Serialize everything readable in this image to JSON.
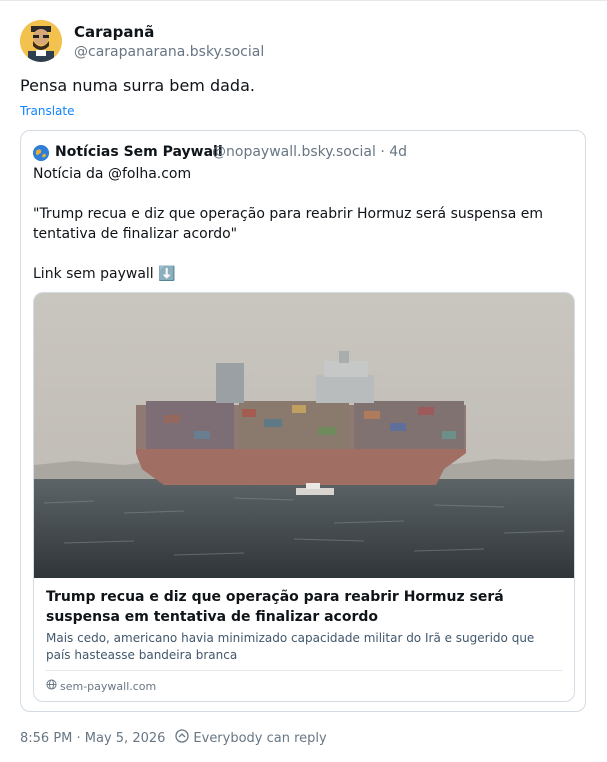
{
  "post": {
    "author_name": "Carapanã",
    "author_handle": "@carapanarana.bsky.social",
    "text": "Pensa numa surra bem dada.",
    "translate_label": "Translate",
    "timestamp": "8:56 PM · May 5, 2026",
    "reply_setting": "Everybody can reply"
  },
  "quote": {
    "author_name": "Notícias Sem Paywall",
    "author_handle": "@nopaywall.bsky.social · 4d",
    "text": "Notícia da @folha.com\n\n\"Trump recua e diz que operação para reabrir Hormuz será suspensa em tentativa de finalizar acordo\"\n\nLink sem paywall ⬇️",
    "card": {
      "title": "Trump recua e diz que operação para reabrir Hormuz será suspensa em tentativa de finalizar acordo",
      "description": "Mais cedo, americano havia minimizado capacidade militar do Irã e sugerido que país hasteasse bandeira branca",
      "domain": "sem-paywall.com"
    }
  },
  "icons": {
    "globe": "globe-icon",
    "reply_setting": "reply-setting-icon"
  }
}
